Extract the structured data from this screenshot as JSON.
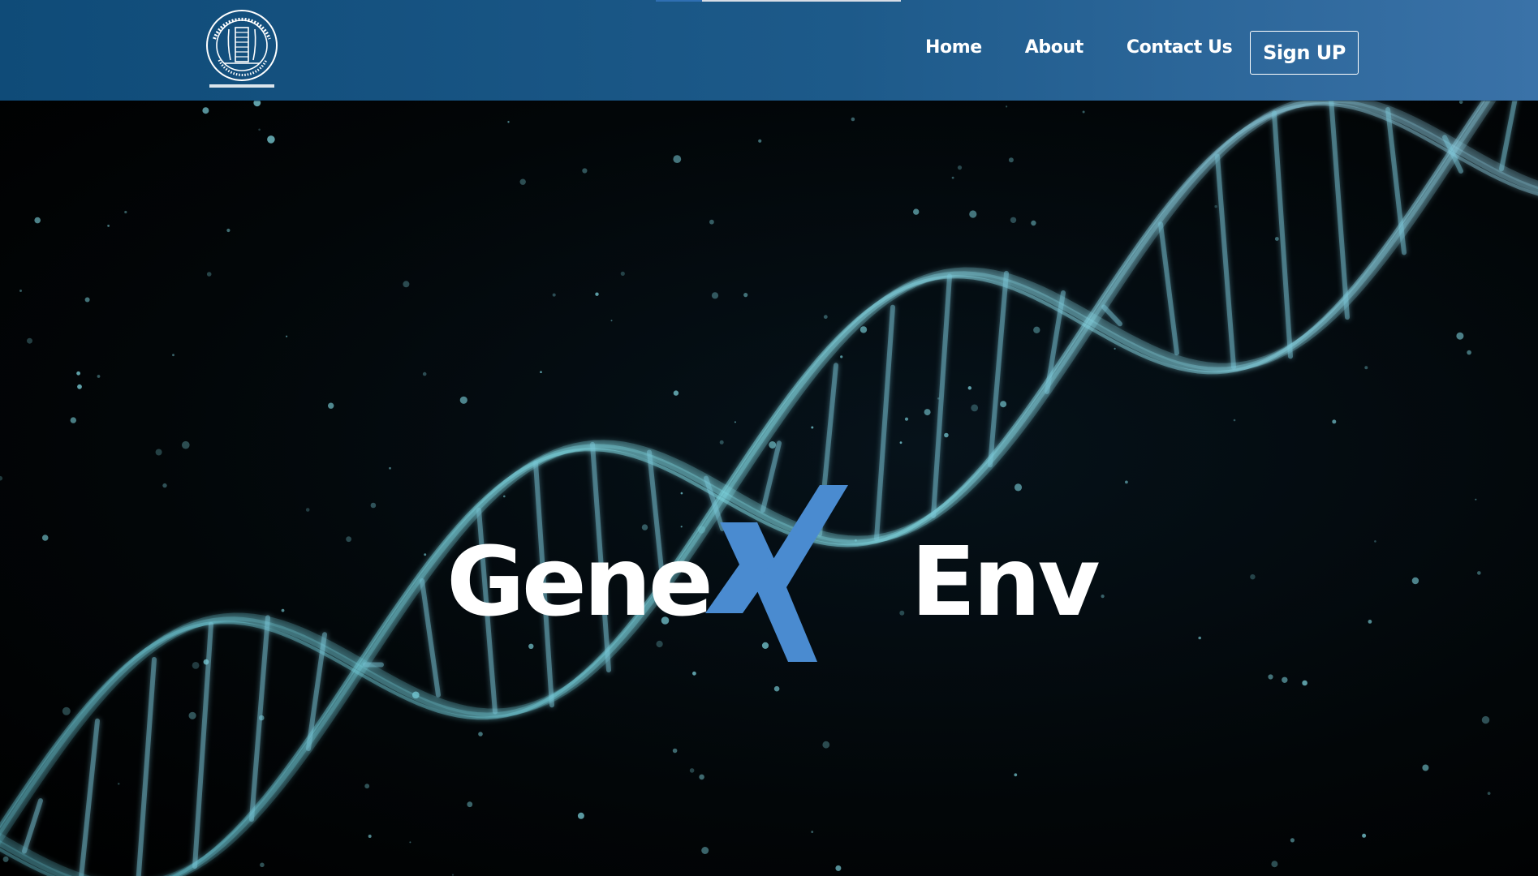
{
  "header": {
    "logo_alt": "|| त्वं ज्ञानमयो विज्ञानमयोऽसि ||",
    "nav": [
      {
        "label": "Home"
      },
      {
        "label": "About"
      },
      {
        "label": "Contact Us"
      }
    ],
    "signup_label": "Sign UP",
    "page_load_progress": 0.19
  },
  "hero": {
    "brand_left": "Gene",
    "brand_right": "Env",
    "background": "dna-helix"
  },
  "colors": {
    "nav_start": "#0f4b78",
    "nav_end": "#3a72a8",
    "brand_x": "#4a8bd0",
    "helix": "#7fd6e0"
  }
}
